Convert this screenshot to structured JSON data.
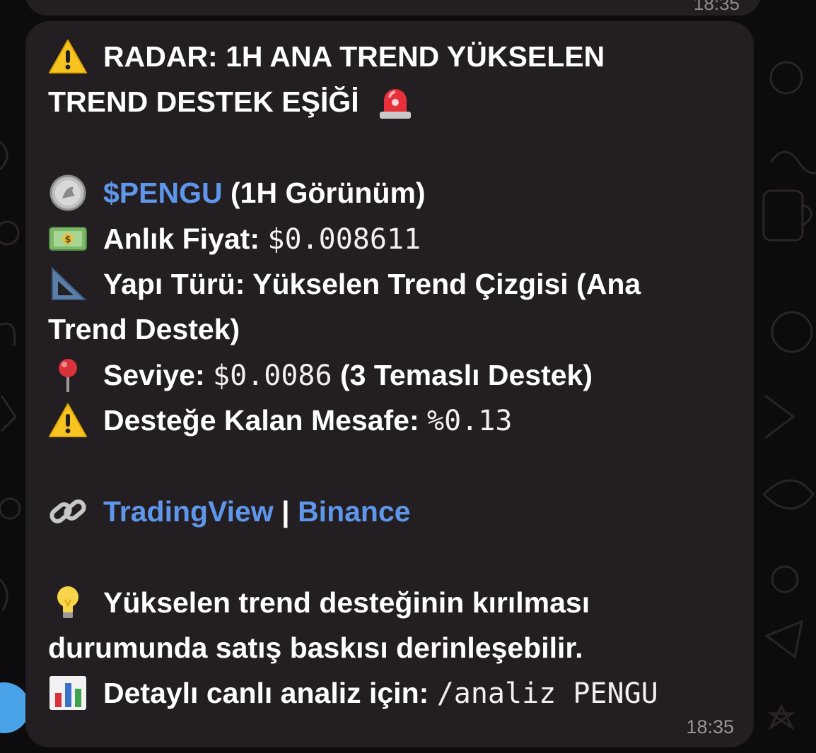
{
  "previous_message": {
    "time": "18:35"
  },
  "message": {
    "title_line1": "RADAR: 1H ANA TREND YÜKSELEN",
    "title_line2": "TREND DESTEK EŞİĞİ",
    "ticker": "$PENGU",
    "view": "(1H Görünüm)",
    "price_label": "Anlık Fiyat:",
    "price_value": "$0.008611",
    "structure_label": "Yapı Türü: Yükselen Trend Çizgisi (Ana",
    "structure_cont": "Trend Destek)",
    "level_label": "Seviye:",
    "level_value": "$0.0086",
    "level_note": "(3 Temaslı Destek)",
    "distance_label": "Desteğe Kalan Mesafe:",
    "distance_value": "%0.13",
    "link_tradingview": "TradingView",
    "link_separator": "|",
    "link_binance": "Binance",
    "tip_line1": "Yükselen trend desteğinin kırılması",
    "tip_line2": "durumunda satış baskısı derinleşebilir.",
    "detail_label": "Detaylı canlı analiz için:",
    "detail_command": "/analiz PENGU",
    "time": "18:35"
  },
  "icons": {
    "warning": "warning-icon",
    "siren": "siren-icon",
    "coin": "coin-icon",
    "money": "money-icon",
    "ruler": "triangular-ruler-icon",
    "pin": "pushpin-icon",
    "link": "link-icon",
    "bulb": "lightbulb-icon",
    "chart": "bar-chart-icon"
  },
  "colors": {
    "bubble": "#231e22",
    "background": "#0d0b0e",
    "link": "#5e96ea",
    "text": "#ffffff",
    "time": "#9b9498"
  }
}
